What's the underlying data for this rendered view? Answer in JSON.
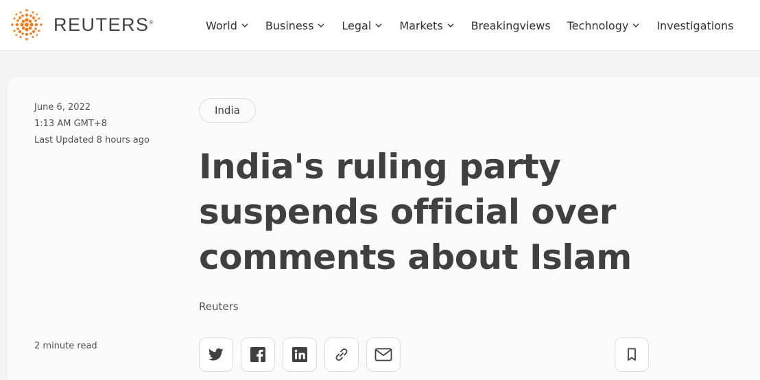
{
  "header": {
    "logo_text": "REUTERS",
    "logo_mark": "®",
    "nav": [
      {
        "label": "World",
        "has_dropdown": true
      },
      {
        "label": "Business",
        "has_dropdown": true
      },
      {
        "label": "Legal",
        "has_dropdown": true
      },
      {
        "label": "Markets",
        "has_dropdown": true
      },
      {
        "label": "Breakingviews",
        "has_dropdown": false
      },
      {
        "label": "Technology",
        "has_dropdown": true
      },
      {
        "label": "Investigations",
        "has_dropdown": false
      }
    ]
  },
  "article": {
    "date": "June 6, 2022",
    "time": "1:13 AM GMT+8",
    "updated": "Last Updated 8 hours ago",
    "read_time": "2 minute read",
    "tag": "India",
    "headline": "India's ruling party suspends official over comments about Islam",
    "author": "Reuters"
  },
  "share_buttons": [
    "twitter-icon",
    "facebook-icon",
    "linkedin-icon",
    "link-icon",
    "email-icon"
  ],
  "bookmark_icon": "bookmark-icon",
  "colors": {
    "logo_orange": "#f07a1a",
    "text": "#404040",
    "background": "#f3f3f4",
    "card": "#fbfbfc"
  }
}
